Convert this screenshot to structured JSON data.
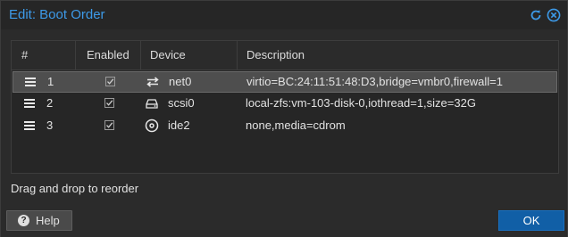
{
  "window": {
    "title": "Edit: Boot Order"
  },
  "grid": {
    "columns": [
      "#",
      "Enabled",
      "Device",
      "Description"
    ],
    "rows": [
      {
        "index": "1",
        "enabled": true,
        "device": "net0",
        "device_icon": "network-arrows-icon",
        "description": "virtio=BC:24:11:51:48:D3,bridge=vmbr0,firewall=1",
        "selected": true
      },
      {
        "index": "2",
        "enabled": true,
        "device": "scsi0",
        "device_icon": "hard-disk-icon",
        "description": "local-zfs:vm-103-disk-0,iothread=1,size=32G",
        "selected": false
      },
      {
        "index": "3",
        "enabled": true,
        "device": "ide2",
        "device_icon": "cdrom-icon",
        "description": "none,media=cdrom",
        "selected": false
      }
    ]
  },
  "hint": "Drag and drop to reorder",
  "footer": {
    "help_label": "Help",
    "ok_label": "OK"
  },
  "colors": {
    "accent": "#3d9ae8",
    "primary_button": "#115fa6",
    "background": "#2b2b2b"
  }
}
